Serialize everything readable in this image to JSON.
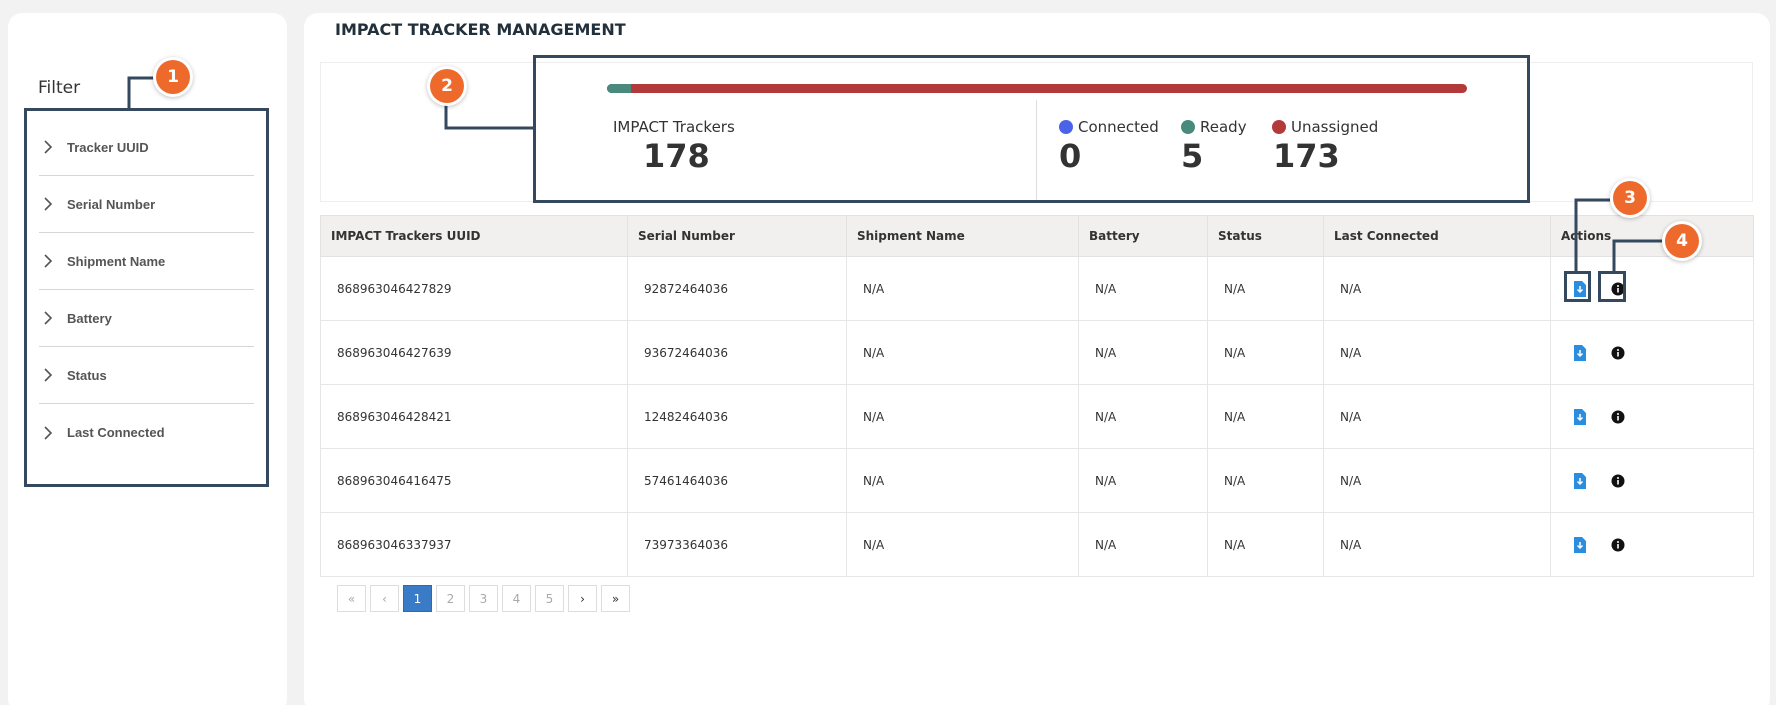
{
  "filter": {
    "title": "Filter",
    "items": [
      {
        "label": "Tracker UUID"
      },
      {
        "label": "Serial Number"
      },
      {
        "label": "Shipment Name"
      },
      {
        "label": "Battery"
      },
      {
        "label": "Status"
      },
      {
        "label": "Last Connected"
      }
    ]
  },
  "page_title": "IMPACT TRACKER MANAGEMENT",
  "summary": {
    "total_label": "IMPACT Trackers",
    "total_value": "178",
    "connected_label": "Connected",
    "connected_value": "0",
    "ready_label": "Ready",
    "ready_value": "5",
    "unassigned_label": "Unassigned",
    "unassigned_value": "173",
    "ready_fraction": 0.028,
    "colors": {
      "connected": "#4b63e8",
      "ready": "#4a8a7c",
      "unassigned": "#b33a3a"
    }
  },
  "table": {
    "headers": [
      "IMPACT Trackers UUID",
      "Serial Number",
      "Shipment Name",
      "Battery",
      "Status",
      "Last Connected",
      "Actions"
    ],
    "rows": [
      [
        "868963046427829",
        "92872464036",
        "N/A",
        "N/A",
        "N/A",
        "N/A"
      ],
      [
        "868963046427639",
        "93672464036",
        "N/A",
        "N/A",
        "N/A",
        "N/A"
      ],
      [
        "868963046428421",
        "12482464036",
        "N/A",
        "N/A",
        "N/A",
        "N/A"
      ],
      [
        "868963046416475",
        "57461464036",
        "N/A",
        "N/A",
        "N/A",
        "N/A"
      ],
      [
        "868963046337937",
        "73973364036",
        "N/A",
        "N/A",
        "N/A",
        "N/A"
      ]
    ],
    "action_icons": [
      "download-icon",
      "info-icon"
    ]
  },
  "pagination": {
    "first": "«",
    "prev": "‹",
    "pages": [
      "1",
      "2",
      "3",
      "4",
      "5"
    ],
    "current": "1",
    "next": "›",
    "last": "»"
  },
  "callouts": [
    "1",
    "2",
    "3",
    "4"
  ],
  "accent": "#ee6a2c"
}
